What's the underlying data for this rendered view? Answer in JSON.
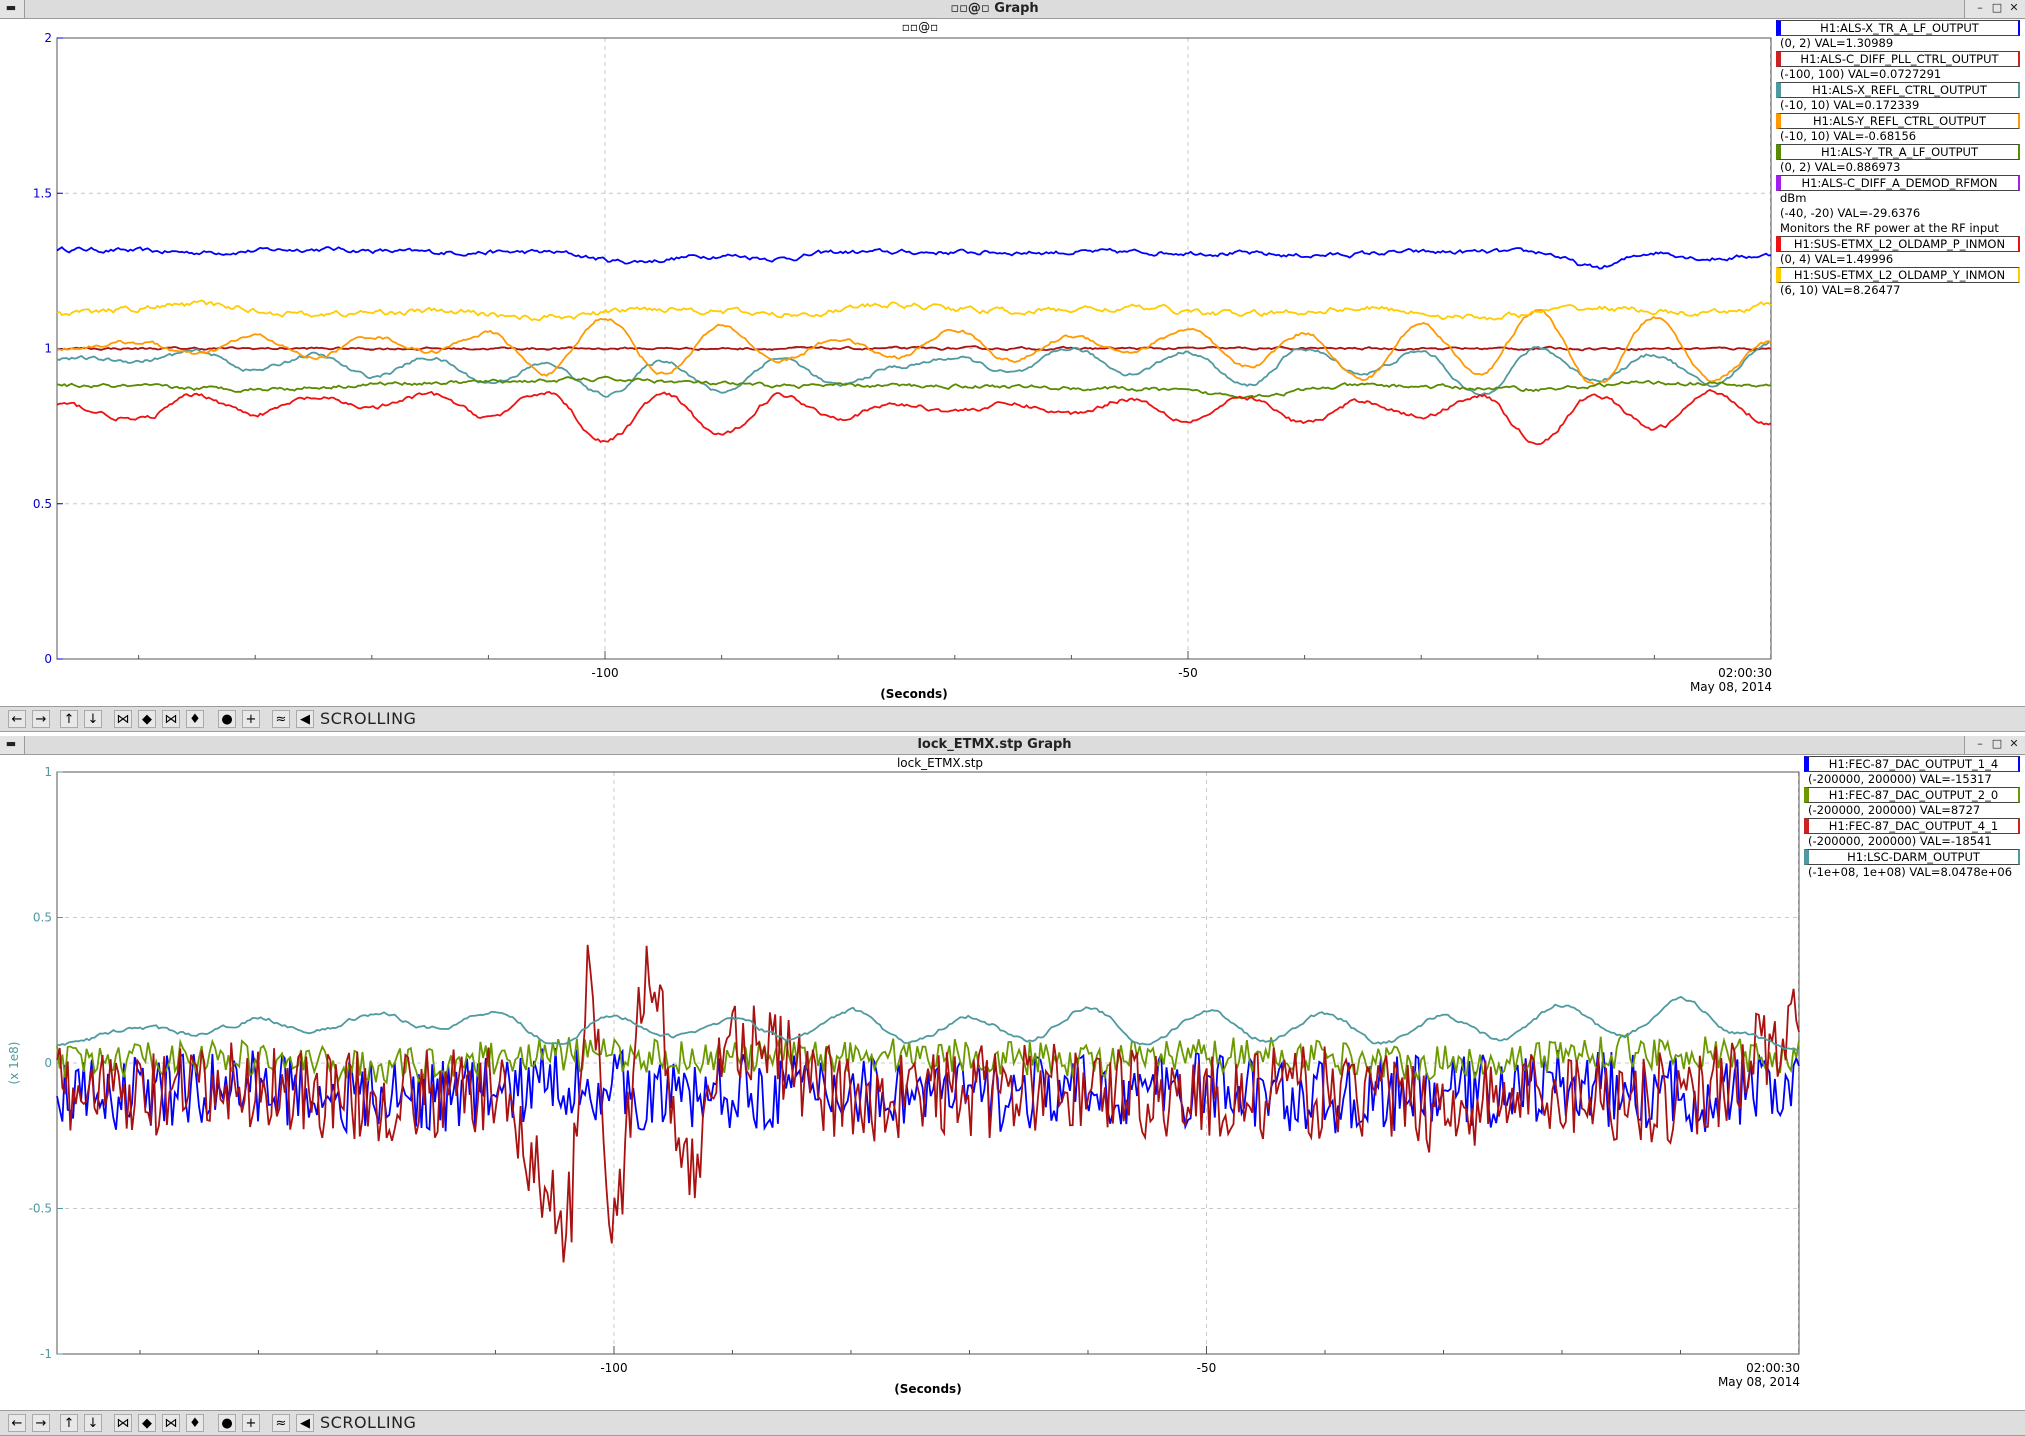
{
  "window1": {
    "title": "▫▫@▫ Graph",
    "subtitle": "▫▫@▫",
    "mode_label": "SCROLLING",
    "date_time": "02:00:30",
    "date": "May 08, 2014",
    "legend": [
      {
        "name": "H1:ALS-X_TR_A_LF_OUTPUT",
        "info": [
          "(0, 2) VAL=1.30989"
        ],
        "color": "#0000ff"
      },
      {
        "name": "H1:ALS-C_DIFF_PLL_CTRL_OUTPUT",
        "info": [
          "(-100, 100) VAL=0.0727291"
        ],
        "color": "#cc2222"
      },
      {
        "name": "H1:ALS-X_REFL_CTRL_OUTPUT",
        "info": [
          "(-10, 10) VAL=0.172339"
        ],
        "color": "#4f9aa0"
      },
      {
        "name": "H1:ALS-Y_REFL_CTRL_OUTPUT",
        "info": [
          "(-10, 10) VAL=-0.68156"
        ],
        "color": "#ff9900"
      },
      {
        "name": "H1:ALS-Y_TR_A_LF_OUTPUT",
        "info": [
          "(0, 2) VAL=0.886973"
        ],
        "color": "#5a8a00"
      },
      {
        "name": "H1:ALS-C_DIFF_A_DEMOD_RFMON",
        "info": [
          "dBm",
          "(-40, -20) VAL=-29.6376",
          "Monitors the RF power at the RF input"
        ],
        "color": "#a020f0"
      },
      {
        "name": "H1:SUS-ETMX_L2_OLDAMP_P_INMON",
        "info": [
          "(0, 4) VAL=1.49996"
        ],
        "color": "#ee1111"
      },
      {
        "name": "H1:SUS-ETMX_L2_OLDAMP_Y_INMON",
        "info": [
          "(6, 10) VAL=8.26477"
        ],
        "color": "#ffcc00"
      }
    ]
  },
  "window2": {
    "title": "lock_ETMX.stp Graph",
    "subtitle": "lock_ETMX.stp",
    "mode_label": "SCROLLING",
    "date_time": "02:00:30",
    "date": "May 08, 2014",
    "legend": [
      {
        "name": "H1:FEC-87_DAC_OUTPUT_1_4",
        "info": [
          "(-200000, 200000) VAL=-15317"
        ],
        "color": "#0000ff"
      },
      {
        "name": "H1:FEC-87_DAC_OUTPUT_2_0",
        "info": [
          "(-200000, 200000) VAL=8727"
        ],
        "color": "#6b9a00"
      },
      {
        "name": "H1:FEC-87_DAC_OUTPUT_4_1",
        "info": [
          "(-200000, 200000) VAL=-18541"
        ],
        "color": "#cc2222"
      },
      {
        "name": "H1:LSC-DARM_OUTPUT",
        "info": [
          "(-1e+08, 1e+08) VAL=8.0478e+06"
        ],
        "color": "#4f9aa0"
      }
    ]
  },
  "chart_data": [
    {
      "type": "line",
      "title": "",
      "xlabel": "(Seconds)",
      "ylabel": "",
      "xlim": [
        -147,
        0
      ],
      "ylim": [
        0,
        2
      ],
      "y_ticks": [
        "0",
        "0.5",
        "1",
        "1.5",
        "2"
      ],
      "x_ticks": [
        "-100",
        "-50"
      ],
      "grid": true,
      "axis_color": "#0000cc",
      "series": [
        {
          "name": "H1:ALS-X_TR_A_LF_OUTPUT",
          "color": "#0000ff",
          "x": [
            -147,
            -135,
            -125,
            -115,
            -105,
            -98,
            -90,
            -85,
            -80,
            -70,
            -60,
            -50,
            -40,
            -30,
            -20,
            -15,
            -10,
            -5,
            0
          ],
          "values": [
            1.32,
            1.31,
            1.32,
            1.31,
            1.31,
            1.28,
            1.3,
            1.29,
            1.31,
            1.31,
            1.31,
            1.31,
            1.3,
            1.31,
            1.31,
            1.26,
            1.31,
            1.29,
            1.3
          ]
        },
        {
          "name": "H1:ALS-C_DIFF_PLL_CTRL_OUTPUT",
          "color": "#aa1111",
          "x": [
            -147,
            -100,
            -50,
            0
          ],
          "values": [
            1.0,
            1.0,
            1.0,
            1.0
          ]
        },
        {
          "name": "H1:ALS-X_REFL_CTRL_OUTPUT",
          "color": "#4f9aa0",
          "x": [
            -147,
            -140,
            -135,
            -130,
            -125,
            -120,
            -115,
            -110,
            -105,
            -100,
            -95,
            -90,
            -85,
            -80,
            -75,
            -70,
            -65,
            -60,
            -55,
            -50,
            -45,
            -40,
            -35,
            -30,
            -25,
            -20,
            -15,
            -10,
            -5,
            0
          ],
          "values": [
            0.97,
            0.96,
            0.99,
            0.93,
            0.98,
            0.91,
            0.97,
            0.89,
            0.95,
            0.85,
            0.96,
            0.86,
            0.97,
            0.88,
            0.94,
            0.97,
            0.92,
            1.0,
            0.92,
            0.99,
            0.88,
            1.0,
            0.92,
            0.99,
            0.85,
            1.0,
            0.9,
            0.98,
            0.88,
            1.02
          ]
        },
        {
          "name": "H1:ALS-Y_REFL_CTRL_OUTPUT",
          "color": "#ff9900",
          "x": [
            -147,
            -140,
            -135,
            -130,
            -125,
            -120,
            -115,
            -110,
            -105,
            -100,
            -95,
            -90,
            -85,
            -80,
            -75,
            -70,
            -65,
            -60,
            -55,
            -50,
            -45,
            -40,
            -35,
            -30,
            -25,
            -20,
            -15,
            -10,
            -5,
            0
          ],
          "values": [
            1.0,
            1.02,
            0.98,
            1.04,
            0.97,
            1.04,
            0.99,
            1.05,
            0.92,
            1.1,
            0.92,
            1.07,
            0.96,
            1.03,
            0.97,
            1.06,
            0.96,
            1.04,
            0.99,
            1.06,
            0.94,
            1.05,
            0.9,
            1.08,
            0.92,
            1.12,
            0.88,
            1.1,
            0.9,
            1.02
          ]
        },
        {
          "name": "H1:ALS-Y_TR_A_LF_OUTPUT",
          "color": "#5a8a00",
          "x": [
            -147,
            -130,
            -115,
            -100,
            -85,
            -70,
            -55,
            -45,
            -35,
            -20,
            -10,
            0
          ],
          "values": [
            0.88,
            0.87,
            0.89,
            0.9,
            0.88,
            0.88,
            0.87,
            0.85,
            0.88,
            0.87,
            0.89,
            0.88
          ]
        },
        {
          "name": "H1:SUS-ETMX_L2_OLDAMP_P_INMON",
          "color": "#ee1111",
          "x": [
            -147,
            -140,
            -135,
            -130,
            -125,
            -120,
            -115,
            -110,
            -105,
            -100,
            -95,
            -90,
            -85,
            -80,
            -75,
            -70,
            -65,
            -60,
            -55,
            -50,
            -45,
            -40,
            -35,
            -30,
            -25,
            -20,
            -15,
            -10,
            -5,
            0
          ],
          "values": [
            0.82,
            0.77,
            0.85,
            0.79,
            0.84,
            0.81,
            0.85,
            0.78,
            0.86,
            0.7,
            0.85,
            0.72,
            0.85,
            0.78,
            0.82,
            0.8,
            0.82,
            0.79,
            0.84,
            0.77,
            0.84,
            0.76,
            0.83,
            0.78,
            0.85,
            0.7,
            0.85,
            0.74,
            0.86,
            0.76
          ]
        },
        {
          "name": "H1:SUS-ETMX_L2_OLDAMP_Y_INMON",
          "color": "#ffcc00",
          "x": [
            -147,
            -135,
            -125,
            -115,
            -105,
            -95,
            -85,
            -75,
            -65,
            -55,
            -45,
            -35,
            -25,
            -15,
            -5,
            0
          ],
          "values": [
            1.11,
            1.14,
            1.11,
            1.12,
            1.1,
            1.13,
            1.11,
            1.14,
            1.12,
            1.13,
            1.11,
            1.13,
            1.1,
            1.13,
            1.11,
            1.14
          ]
        }
      ]
    },
    {
      "type": "line",
      "title": "lock_ETMX.stp",
      "xlabel": "(Seconds)",
      "ylabel": "(x 1e8)",
      "xlim": [
        -147,
        0
      ],
      "ylim": [
        -1,
        1
      ],
      "y_ticks": [
        "-1",
        "-0.5",
        "0",
        "0.5",
        "1"
      ],
      "x_ticks": [
        "-100",
        "-50"
      ],
      "grid": true,
      "axis_color": "#4f9aa0",
      "series": [
        {
          "name": "H1:FEC-87_DAC_OUTPUT_1_4",
          "color": "#0000ff",
          "x": [
            -147,
            -140,
            -130,
            -120,
            -110,
            -104,
            -100,
            -96,
            -90,
            -80,
            -70,
            -60,
            -50,
            -40,
            -30,
            -20,
            -10,
            0
          ],
          "values": [
            -0.12,
            -0.1,
            -0.08,
            -0.12,
            -0.1,
            -0.06,
            -0.08,
            -0.12,
            -0.1,
            -0.09,
            -0.11,
            -0.1,
            -0.09,
            -0.12,
            -0.1,
            -0.08,
            -0.11,
            -0.09
          ]
        },
        {
          "name": "H1:FEC-87_DAC_OUTPUT_2_0",
          "color": "#6b9a00",
          "x": [
            -147,
            -135,
            -120,
            -105,
            -90,
            -75,
            -60,
            -45,
            -30,
            -15,
            0
          ],
          "values": [
            0.0,
            0.02,
            -0.01,
            0.03,
            0.02,
            0.03,
            0.01,
            0.03,
            0.0,
            0.04,
            0.02
          ]
        },
        {
          "name": "H1:FEC-87_DAC_OUTPUT_4_1",
          "color": "#aa1111",
          "x": [
            -147,
            -140,
            -130,
            -120,
            -110,
            -104,
            -102,
            -100,
            -97,
            -94,
            -90,
            -80,
            -70,
            -60,
            -50,
            -40,
            -30,
            -20,
            -10,
            0
          ],
          "values": [
            -0.1,
            -0.12,
            -0.08,
            -0.12,
            -0.1,
            -0.55,
            0.3,
            -0.5,
            0.32,
            -0.4,
            0.1,
            -0.12,
            -0.1,
            -0.08,
            -0.12,
            -0.1,
            -0.15,
            -0.1,
            -0.12,
            0.1
          ]
        },
        {
          "name": "H1:LSC-DARM_OUTPUT",
          "color": "#4f9aa0",
          "x": [
            -147,
            -140,
            -135,
            -130,
            -125,
            -120,
            -115,
            -110,
            -105,
            -100,
            -95,
            -90,
            -85,
            -80,
            -75,
            -70,
            -65,
            -60,
            -55,
            -50,
            -45,
            -40,
            -35,
            -30,
            -25,
            -20,
            -15,
            -10,
            -5,
            0
          ],
          "values": [
            0.06,
            0.12,
            0.1,
            0.15,
            0.11,
            0.17,
            0.12,
            0.18,
            0.07,
            0.16,
            0.09,
            0.15,
            0.08,
            0.18,
            0.07,
            0.16,
            0.08,
            0.19,
            0.06,
            0.18,
            0.08,
            0.17,
            0.07,
            0.16,
            0.08,
            0.2,
            0.09,
            0.22,
            0.1,
            0.04
          ]
        }
      ]
    }
  ]
}
